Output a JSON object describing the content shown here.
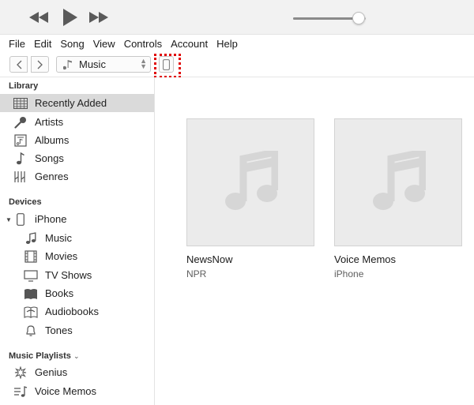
{
  "transport": {
    "icons": [
      "rewind-icon",
      "play-icon",
      "fast-forward-icon"
    ],
    "volume_level": 0.9
  },
  "menu": [
    "File",
    "Edit",
    "Song",
    "View",
    "Controls",
    "Account",
    "Help"
  ],
  "navbar": {
    "media_kind": "Music",
    "media_icon": "music-note-icon",
    "device_icon": "iphone-icon",
    "highlight_color": "#e00000"
  },
  "sidebar": {
    "library_heading": "Library",
    "library": [
      {
        "label": "Recently Added",
        "icon": "recently-added-icon",
        "selected": true
      },
      {
        "label": "Artists",
        "icon": "microphone-icon"
      },
      {
        "label": "Albums",
        "icon": "album-icon"
      },
      {
        "label": "Songs",
        "icon": "music-note-icon"
      },
      {
        "label": "Genres",
        "icon": "genres-icon"
      }
    ],
    "devices_heading": "Devices",
    "device": {
      "label": "iPhone",
      "icon": "iphone-icon"
    },
    "device_items": [
      {
        "label": "Music",
        "icon": "music-note-icon"
      },
      {
        "label": "Movies",
        "icon": "film-icon"
      },
      {
        "label": "TV Shows",
        "icon": "tv-icon"
      },
      {
        "label": "Books",
        "icon": "book-icon"
      },
      {
        "label": "Audiobooks",
        "icon": "audiobook-icon"
      },
      {
        "label": "Tones",
        "icon": "bell-icon"
      }
    ],
    "playlists_heading": "Music Playlists",
    "playlists": [
      {
        "label": "Genius",
        "icon": "genius-icon"
      },
      {
        "label": "Voice Memos",
        "icon": "playlist-icon"
      }
    ]
  },
  "albums": [
    {
      "title": "NewsNow",
      "artist": "NPR"
    },
    {
      "title": "Voice Memos",
      "artist": "iPhone"
    }
  ],
  "colors": {
    "selected_row": "#dadada",
    "artwork_bg": "#ebebeb",
    "artwork_note": "#d6d6d6"
  }
}
